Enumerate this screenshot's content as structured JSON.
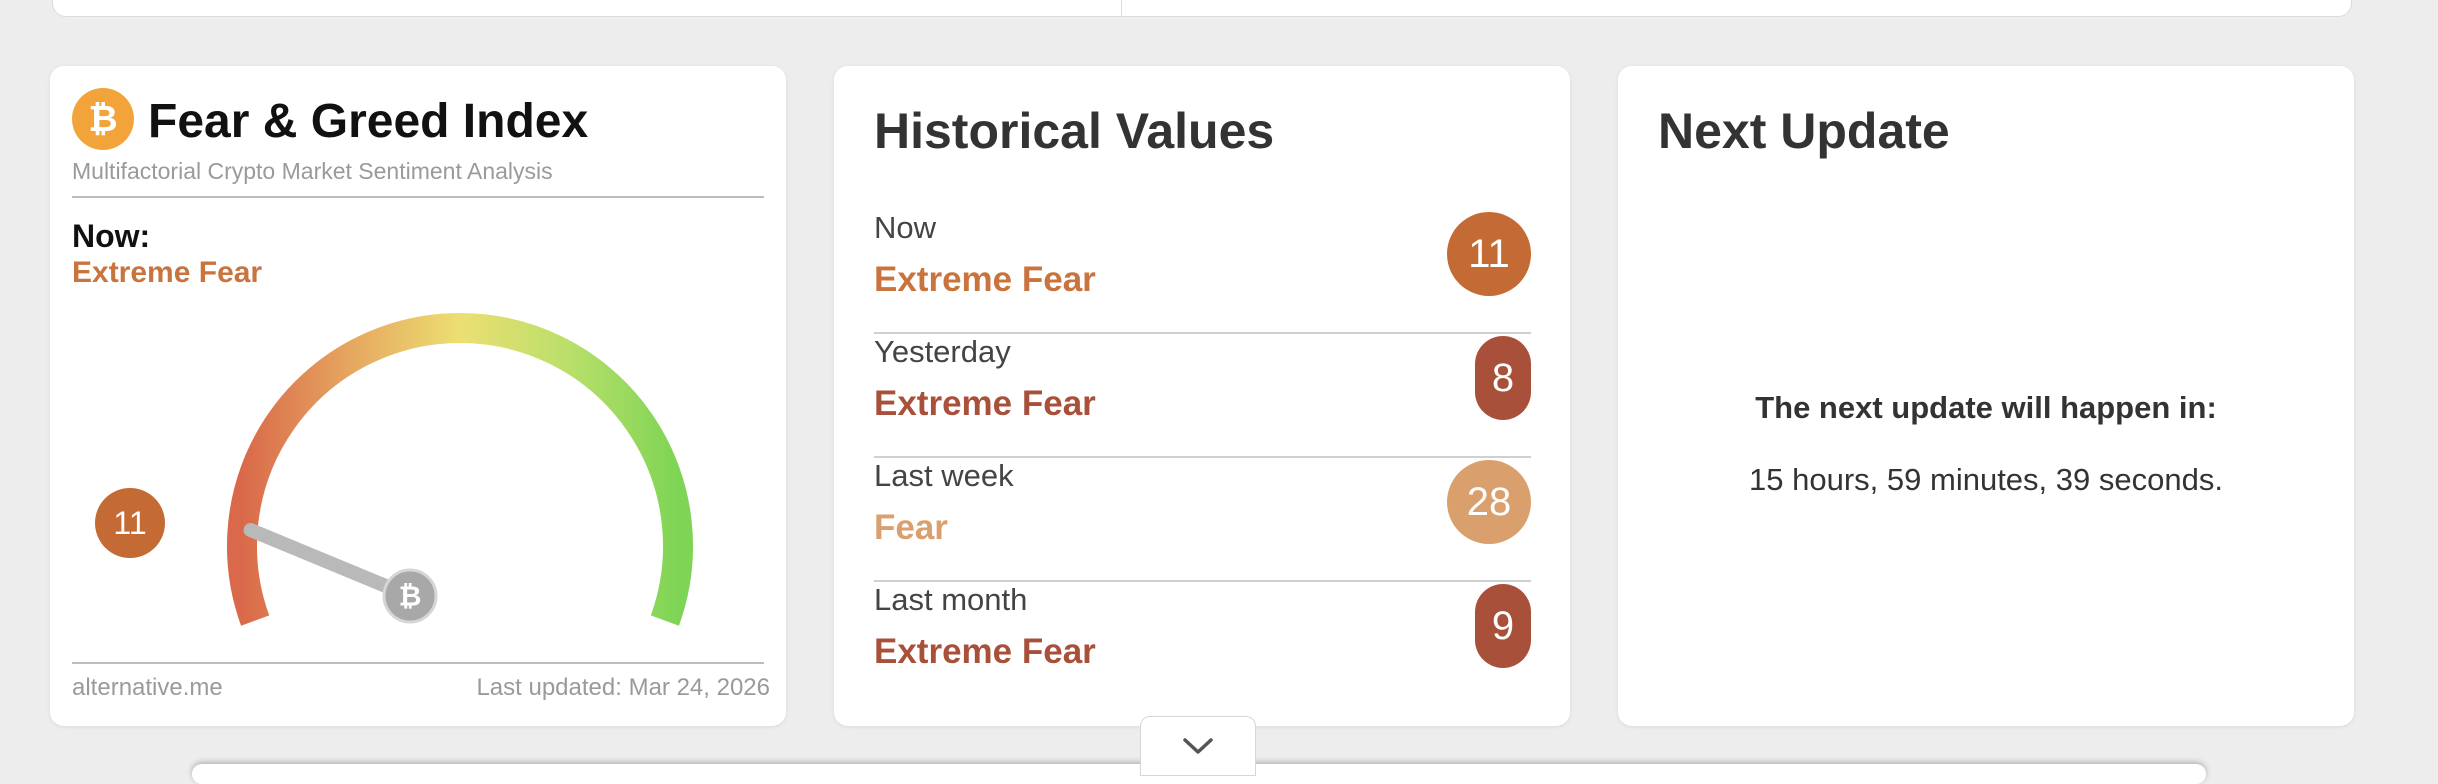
{
  "fear_greed": {
    "logo": "₿",
    "title": "Fear & Greed Index",
    "subtitle": "Multifactorial Crypto Market Sentiment Analysis",
    "now_label": "Now:",
    "now_classification": "Extreme Fear",
    "value": 11,
    "value_label": "11",
    "gauge_min": 0,
    "gauge_max": 100,
    "needle_icon": "bitcoin-icon",
    "source": "alternative.me",
    "last_updated": "Last updated: Mar 24, 2026"
  },
  "historical": {
    "title": "Historical Values",
    "rows": [
      {
        "period": "Now",
        "classification": "Extreme Fear",
        "value": "11",
        "badge_color": "#c46a35",
        "text_color": "#c9743e"
      },
      {
        "period": "Yesterday",
        "classification": "Extreme Fear",
        "value": "8",
        "badge_color": "#a9503a",
        "text_color": "#a9503a"
      },
      {
        "period": "Last week",
        "classification": "Fear",
        "value": "28",
        "badge_color": "#d9a06d",
        "text_color": "#d9a06d"
      },
      {
        "period": "Last month",
        "classification": "Extreme Fear",
        "value": "9",
        "badge_color": "#a9503a",
        "text_color": "#a9503a"
      }
    ]
  },
  "next_update": {
    "title": "Next Update",
    "message": "The next update will happen in:",
    "countdown": "15 hours, 59 minutes, 39 seconds."
  },
  "colors": {
    "extreme_fear": "#c46a35",
    "fear": "#d9a06d",
    "greed_green": "#7cd34a",
    "card_bg": "#ffffff",
    "page_bg": "#ededed"
  },
  "icons": {
    "expand": "chevron-down-icon"
  }
}
